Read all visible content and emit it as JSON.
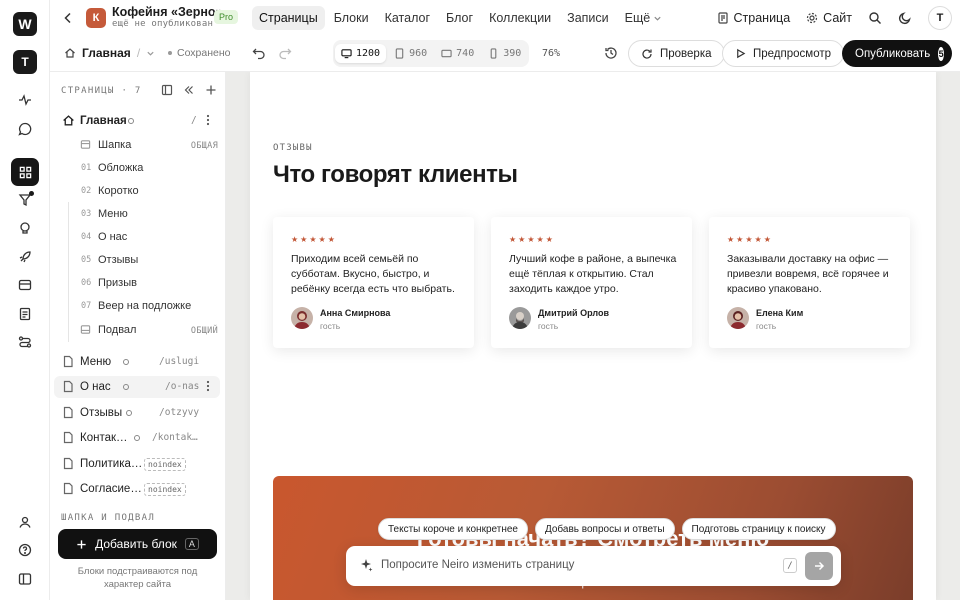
{
  "rail": {
    "workspace_logo": "W",
    "account_logo": "T",
    "icons": [
      "activity-icon",
      "chat-icon",
      "blocks-icon",
      "funnel-icon",
      "brain-icon",
      "rocket-icon",
      "media-icon",
      "document-icon",
      "flow-icon",
      "user-icon",
      "help-icon",
      "panel-icon"
    ]
  },
  "project": {
    "logo_letter": "К",
    "name": "Кофейня «Зерно»",
    "status": "ещё не опубликован",
    "plan": "Pro"
  },
  "nav": {
    "items": [
      "Страницы",
      "Блоки",
      "Каталог",
      "Блог",
      "Коллекции",
      "Записи",
      "Ещё"
    ],
    "active": "Страницы"
  },
  "topright": {
    "page_link": "Страница",
    "site_link": "Сайт",
    "avatar": "T"
  },
  "toolbar": {
    "breadcrumb_title": "Главная",
    "breadcrumb_sep": "/",
    "saved": "Сохранено",
    "viewports": [
      "1200",
      "960",
      "740",
      "390"
    ],
    "active_viewport": "1200",
    "zoom": "76%",
    "review": "Проверка",
    "preview": "Предпросмотр",
    "publish": "Опубликовать",
    "publish_count": "5"
  },
  "sidebar": {
    "header": "СТРАНИЦЫ · 7",
    "home": {
      "label": "Главная",
      "slug": "/"
    },
    "home_blocks": [
      {
        "num": "",
        "label": "Шапка",
        "tag": "ОБЩАЯ"
      },
      {
        "num": "01",
        "label": "Обложка",
        "tag": ""
      },
      {
        "num": "02",
        "label": "Коротко",
        "tag": ""
      },
      {
        "num": "03",
        "label": "Меню",
        "tag": ""
      },
      {
        "num": "04",
        "label": "О нас",
        "tag": ""
      },
      {
        "num": "05",
        "label": "Отзывы",
        "tag": ""
      },
      {
        "num": "06",
        "label": "Призыв",
        "tag": ""
      },
      {
        "num": "07",
        "label": "Веер на подложке",
        "tag": ""
      },
      {
        "num": "",
        "label": "Подвал",
        "tag": "ОБЩИЙ"
      }
    ],
    "pages": [
      {
        "label": "Меню",
        "slug": "/uslugi",
        "badge": ""
      },
      {
        "label": "О нас",
        "slug": "/o-nas",
        "badge": ""
      },
      {
        "label": "Отзывы",
        "slug": "/otzyvy",
        "badge": ""
      },
      {
        "label": "Контак…",
        "slug": "/kontak…",
        "badge": ""
      },
      {
        "label": "Политика…",
        "slug": "",
        "badge": "noindex"
      },
      {
        "label": "Согласие…",
        "slug": "",
        "badge": "noindex"
      }
    ],
    "section2": "ШАПКА И ПОДВАЛ",
    "add_block": "Добавить блок",
    "add_block_key": "A",
    "hint": "Блоки подстраиваются под характер сайта"
  },
  "canvas": {
    "kicker": "ОТЗЫВЫ",
    "heading": "Что говорят клиенты",
    "reviews": [
      {
        "stars": "★★★★★",
        "text": "Приходим всей семьёй по субботам. Вкусно, быстро, и ребёнку всегда есть что выбрать.",
        "name": "Анна Смирнова",
        "role": "гость"
      },
      {
        "stars": "★★★★★",
        "text": "Лучший кофе в районе, а выпечка ещё тёплая к открытию. Стал заходить каждое утро.",
        "name": "Дмитрий Орлов",
        "role": "гость"
      },
      {
        "stars": "★★★★★",
        "text": "Заказывали доставку на офис — привезли вовремя, всё горячее и красиво упаковано.",
        "name": "Елена Ким",
        "role": "гость"
      }
    ],
    "cta_title": "Готовы начать? Смотреть меню",
    "cta_sub": "время."
  },
  "ai": {
    "suggestions": [
      "Тексты короче и конкретнее",
      "Добавь вопросы и ответы",
      "Подготовь страницу к поиску"
    ],
    "placeholder": "Попросите Neiro изменить страницу",
    "shortcut": "/"
  },
  "colors": {
    "accent": "#c25636",
    "dark": "#111111",
    "pro_green": "#3f8c2c"
  }
}
